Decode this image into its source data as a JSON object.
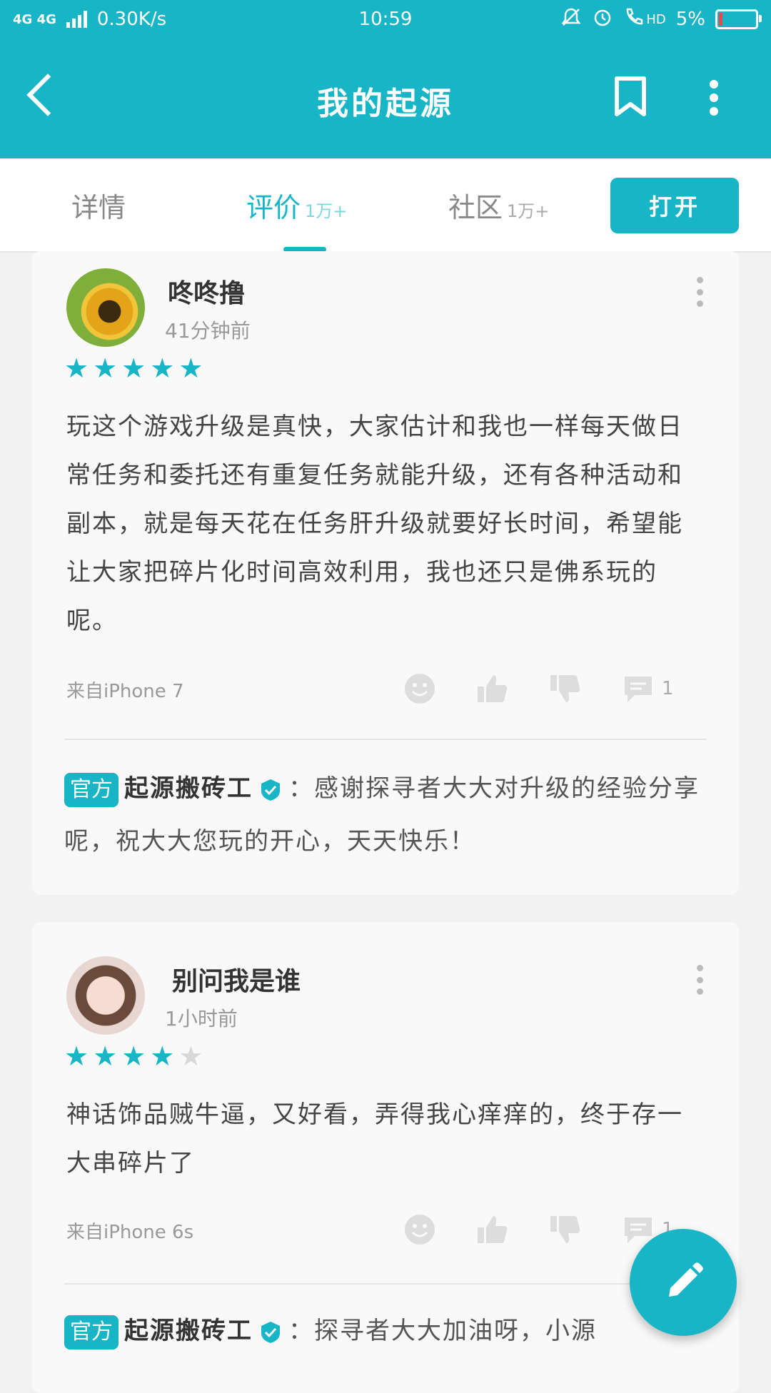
{
  "status": {
    "network": "4G 4G",
    "speed": "0.30K/s",
    "time": "10:59",
    "hd": "HD",
    "battery_text": "5%",
    "battery_level": 0.05
  },
  "appbar": {
    "title": "我的起源"
  },
  "tabs": [
    {
      "label": "详情",
      "count": ""
    },
    {
      "label": "评价",
      "count": "1万+"
    },
    {
      "label": "社区",
      "count": "1万+"
    }
  ],
  "open_button": "打开",
  "reviews": [
    {
      "user": "咚咚撸",
      "time": "41分钟前",
      "rating": 5,
      "text": "玩这个游戏升级是真快，大家估计和我也一样每天做日常任务和委托还有重复任务就能升级，还有各种活动和副本，就是每天花在任务肝升级就要好长时间，希望能让大家把碎片化时间高效利用，我也还只是佛系玩的呢。",
      "device": "来自iPhone 7",
      "comment_count": "1",
      "reply": {
        "badge": "官方",
        "author": "起源搬砖工",
        "text": "：感谢探寻者大大对升级的经验分享呢，祝大大您玩的开心，天天快乐！"
      }
    },
    {
      "user": "别问我是谁",
      "time": "1小时前",
      "rating": 4,
      "text": "神话饰品贼牛逼，又好看，弄得我心痒痒的，终于存一大串碎片了",
      "device": "来自iPhone 6s",
      "comment_count": "1",
      "reply": {
        "badge": "官方",
        "author": "起源搬砖工",
        "text": "：探寻者大大加油呀，小源"
      }
    }
  ],
  "colors": {
    "accent": "#17b5c6",
    "star_off": "#d8d8d8"
  },
  "icons": [
    "back-arrow-icon",
    "bookmark-icon",
    "more-vert-icon",
    "smile-icon",
    "thumbs-up-icon",
    "thumbs-down-icon",
    "comment-icon",
    "verified-icon",
    "edit-pencil-icon"
  ]
}
